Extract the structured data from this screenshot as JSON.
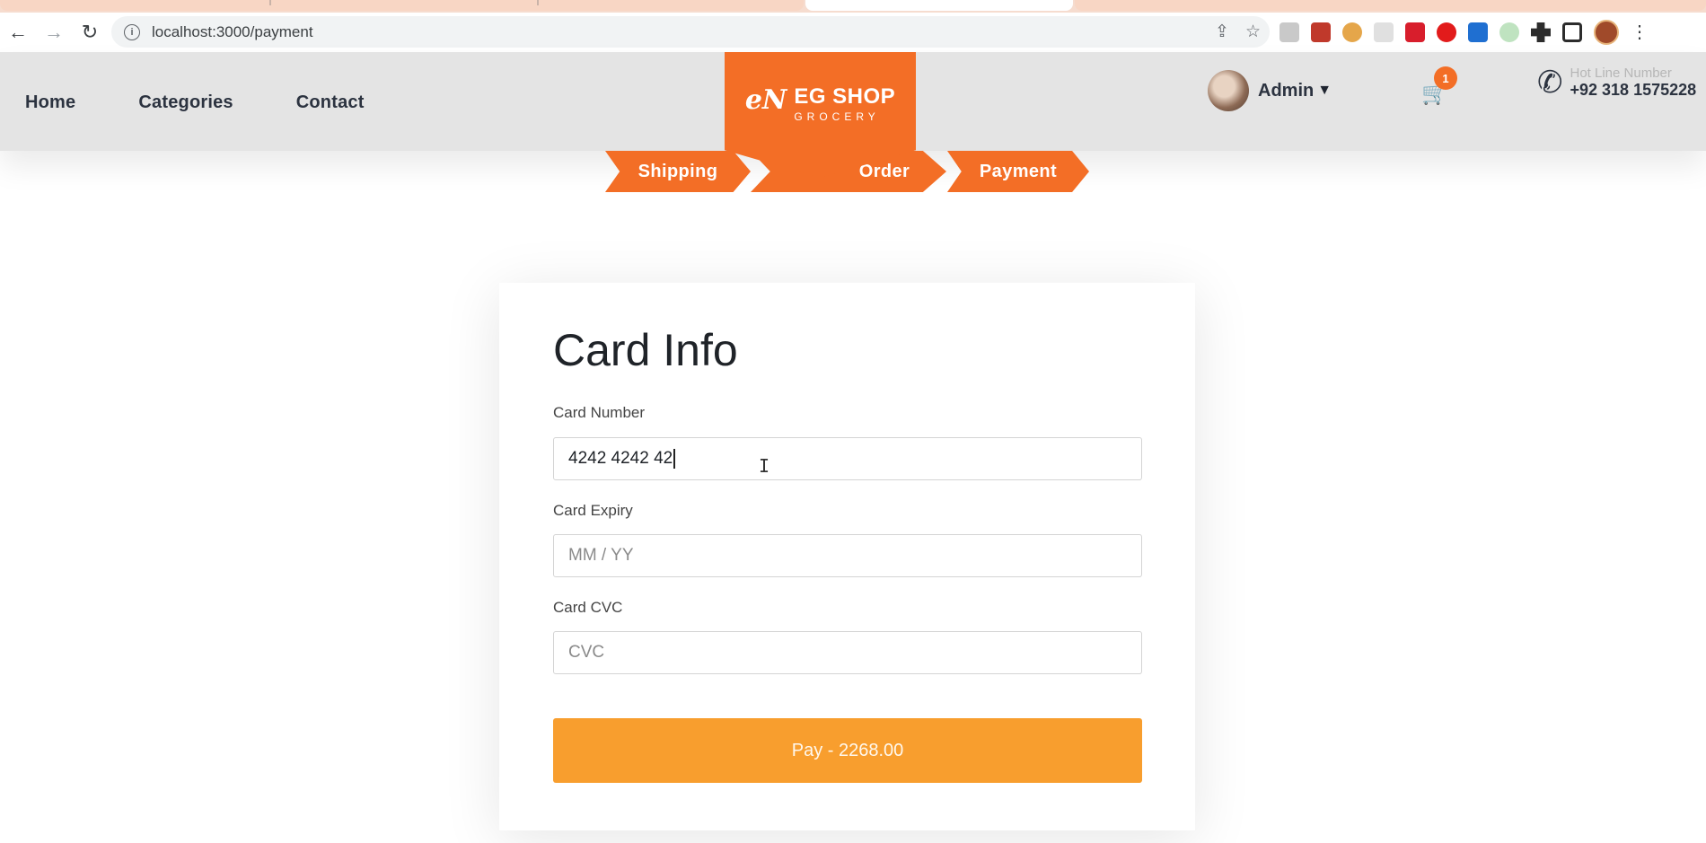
{
  "browser": {
    "url": "localhost:3000/payment",
    "back_icon": "←",
    "forward_icon": "→",
    "reload_icon": "↻",
    "info_icon": "i",
    "share_icon": "⇪",
    "star_icon": "☆",
    "menu_icon": "⋮"
  },
  "nav": {
    "home": "Home",
    "categories": "Categories",
    "contact": "Contact"
  },
  "logo": {
    "mark": "eN",
    "line1": "EG SHOP",
    "line2": "GROCERY"
  },
  "user": {
    "name": "Admin",
    "caret": "▼"
  },
  "cart": {
    "icon": "🛒",
    "count": "1"
  },
  "hotline": {
    "icon": "✆",
    "label": "Hot Line Number",
    "number": "+92 318 1575228"
  },
  "steps": {
    "shipping": "Shipping",
    "order": "Order",
    "payment": "Payment"
  },
  "form": {
    "title": "Card Info",
    "card_number_label": "Card Number",
    "card_number_value": "4242 4242 42",
    "card_expiry_label": "Card Expiry",
    "card_expiry_placeholder": "MM / YY",
    "card_cvc_label": "Card CVC",
    "card_cvc_placeholder": "CVC",
    "pay_button": "Pay - 2268.00"
  },
  "colors": {
    "brand": "#f36e26",
    "pay_button": "#f89e2e"
  }
}
